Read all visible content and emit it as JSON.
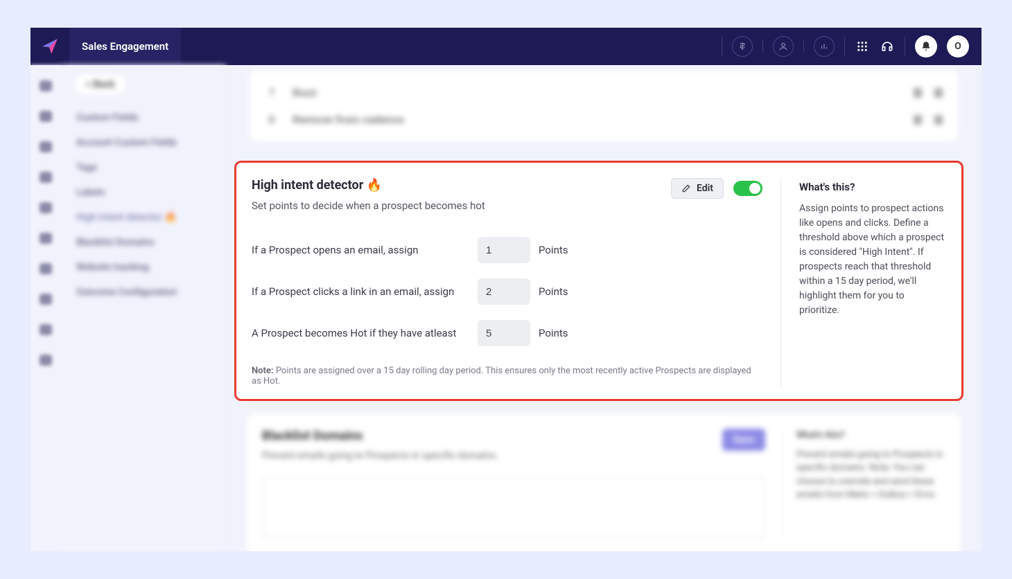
{
  "nav": {
    "title": "Sales Engagement",
    "avatar_initial": "O"
  },
  "sidebar": {
    "back": "< Back",
    "items": [
      "Custom Fields",
      "Account Custom Fields",
      "Tags",
      "Labels",
      "High intent detector 🔥",
      "Blacklist Domains",
      "Website tracking",
      "Outcome Configuration"
    ]
  },
  "top_rows": [
    {
      "num": "7",
      "label": "Buzz"
    },
    {
      "num": "8",
      "label": "Remove from cadence"
    }
  ],
  "hid": {
    "title": "High intent detector 🔥",
    "subtitle": "Set points to decide when a prospect becomes hot",
    "edit_label": "Edit",
    "toggle_on": true,
    "rules": [
      {
        "label": "If a Prospect opens an email, assign",
        "value": "1",
        "unit": "Points"
      },
      {
        "label": "If a Prospect clicks a link in an email, assign",
        "value": "2",
        "unit": "Points"
      },
      {
        "label": "A Prospect becomes Hot if they have atleast",
        "value": "5",
        "unit": "Points"
      }
    ],
    "note_prefix": "Note:",
    "note_body": " Points are assigned over a 15 day rolling day period. This ensures only the most recently active Prospects are displayed as Hot.",
    "whats_title": "What's this?",
    "whats_body": "Assign points to prospect actions like opens and clicks. Define a threshold above which a prospect is considered \"High Intent\". If prospects reach that threshold within a 15 day period, we'll highlight them for you to prioritize."
  },
  "bottom": {
    "title": "Blacklist Domains",
    "subtitle": "Prevent emails going to Prospects in specific domains.",
    "save_label": "Save",
    "whats_title": "What's this?",
    "whats_body": "Prevent emails going to Prospects in specific domains. Note: You can choose to override and send these emails from Mails > Outbox > Error."
  }
}
